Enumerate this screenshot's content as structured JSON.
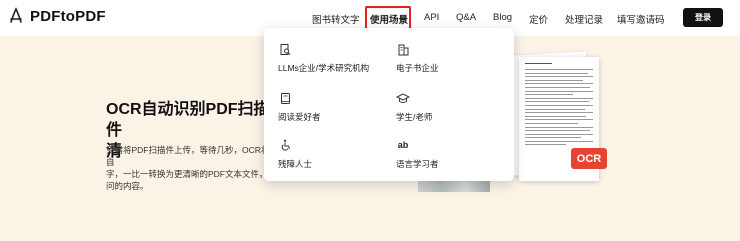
{
  "brand": {
    "name": "PDFtoPDF"
  },
  "nav": {
    "items": [
      {
        "label": "图书转文字"
      },
      {
        "label": "使用场景"
      },
      {
        "label": "API"
      },
      {
        "label": "Q&A"
      },
      {
        "label": "Blog"
      },
      {
        "label": "定价"
      },
      {
        "label": "处理记录"
      },
      {
        "label": "填写邀请码"
      }
    ],
    "active": "使用场景",
    "login_label": "登录"
  },
  "hero": {
    "title": "OCR自动识别PDF扫描件\n清",
    "description": "只需将PDF扫描件上传，等待几秒，OCR将自\n字，一比一转换为更清晰的PDF文本文件，从\n问的内容。"
  },
  "dropdown": {
    "items": [
      {
        "label": "LLMs企业/学术研究机构",
        "icon": "building-search-icon"
      },
      {
        "label": "电子书企业",
        "icon": "office-building-icon"
      },
      {
        "label": "阅读爱好者",
        "icon": "book-icon"
      },
      {
        "label": "学生/老师",
        "icon": "graduation-cap-icon"
      },
      {
        "label": "残障人士",
        "icon": "wheelchair-icon"
      },
      {
        "label": "语言学习者",
        "icon": "ab-letters-icon",
        "glyph": "ab"
      }
    ]
  },
  "preview": {
    "badge": "OCR"
  },
  "colors": {
    "accent": "#e64433",
    "highlight": "#e02020",
    "background": "#fbf3e6"
  }
}
